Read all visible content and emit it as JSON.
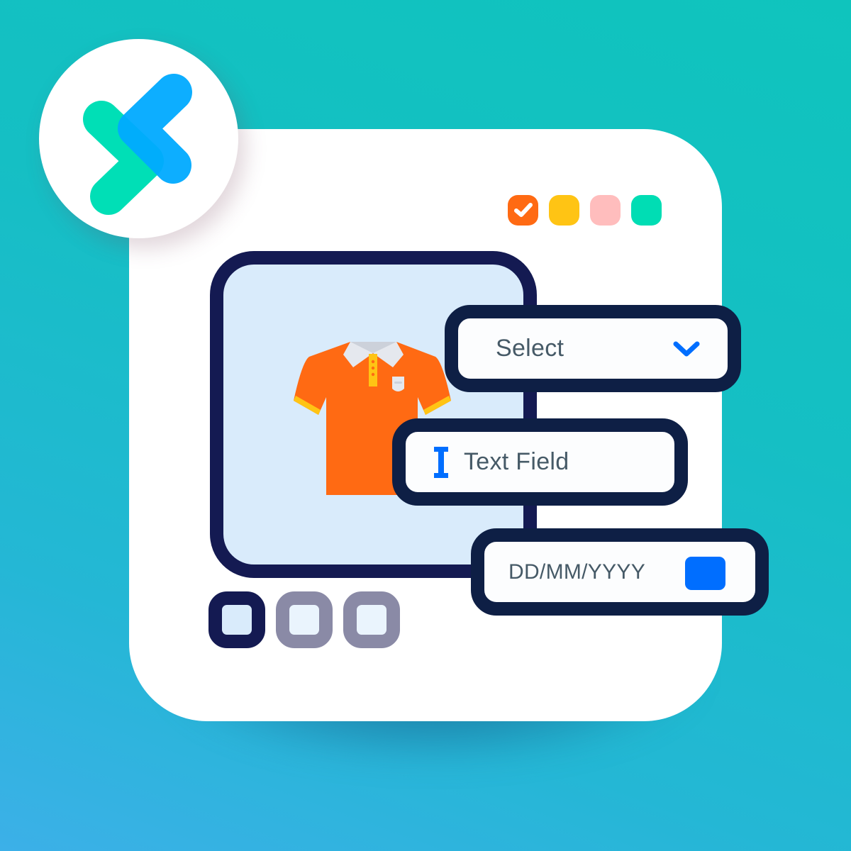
{
  "logo": {
    "icon": "chevrons-x-logo",
    "colors": {
      "green": "#00dfb6",
      "blue": "#00aaff",
      "overlap": "#0090ff"
    }
  },
  "window": {
    "status_dots": [
      {
        "name": "check-dot",
        "color": "#ff6a13",
        "checked": true
      },
      {
        "name": "yellow-dot",
        "color": "#ffc414",
        "checked": false
      },
      {
        "name": "pink-dot",
        "color": "#ffbdbd",
        "checked": false
      },
      {
        "name": "green-dot",
        "color": "#00ddb4",
        "checked": false
      }
    ]
  },
  "product": {
    "icon": "polo-shirt-icon",
    "colors": {
      "body": "#ff6a13",
      "trim": "#ffc414",
      "collar": "#e5e8ee"
    }
  },
  "form": {
    "select": {
      "label": "Select",
      "icon": "chevron-down-icon"
    },
    "text_field": {
      "label": "Text Field",
      "icon": "text-cursor-icon"
    },
    "date_field": {
      "placeholder": "DD/MM/YYYY",
      "icon": "calendar-square-icon"
    }
  },
  "thumbnails": {
    "count": 3,
    "selected_index": 0
  },
  "colors": {
    "accent": "#006eff",
    "navy": "#141a52",
    "text": "#465a67"
  }
}
